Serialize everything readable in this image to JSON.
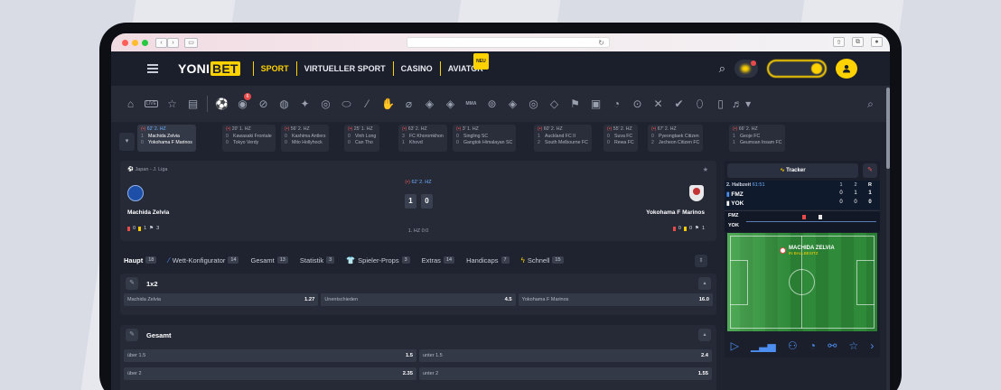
{
  "nav": {
    "logo_a": "YONI",
    "logo_b": "BET",
    "items": [
      "SPORT",
      "VIRTUELLER SPORT",
      "CASINO",
      "AVIATOR"
    ],
    "new_badge": "NEU"
  },
  "sports_icons": [
    "home-icon",
    "live-icon",
    "favorites-icon",
    "betslip-icon",
    "soccer-icon",
    "pitch-live-icon",
    "tennis-icon",
    "basketball-icon",
    "hockey-icon",
    "volleyball-icon",
    "rugby-icon",
    "baseball-icon",
    "handball-icon",
    "cricket-icon",
    "esports-soccer-icon",
    "esports-basket-icon",
    "mma-icon",
    "cycling-icon",
    "boxing-icon",
    "darts-icon",
    "table-tennis-icon",
    "flag-icon",
    "vr-icon",
    "snooker-icon",
    "golf-icon",
    "badminton-icon",
    "beach-icon",
    "rugby-league-icon",
    "chess-icon",
    "more-icon"
  ],
  "sports_bar": {
    "live_label": "LIVE",
    "mma_label": "MMA",
    "live_badge": "6"
  },
  "ticker": [
    {
      "time": "62' 2. HZ",
      "home_score": "1",
      "home": "Machida Zelvia",
      "away_score": "0",
      "away": "Yokohama F Marinos"
    },
    {
      "time": "20' 1. HZ",
      "home_score": "0",
      "home": "Kawasaki Frontale",
      "away_score": "0",
      "away": "Tokyo Verdy"
    },
    {
      "time": "56' 2. HZ",
      "home_score": "0",
      "home": "Kashima Antlers",
      "away_score": "0",
      "away": "Mito Hollyhock"
    },
    {
      "time": "25' 1. HZ",
      "home_score": "0",
      "home": "Vinh Long",
      "away_score": "0",
      "away": "Can Tho"
    },
    {
      "time": "63' 2. HZ",
      "home_score": "3",
      "home": "FC Khoromkhon",
      "away_score": "1",
      "away": "Khovd"
    },
    {
      "time": "3' 1. HZ",
      "home_score": "0",
      "home": "Singling SC",
      "away_score": "0",
      "away": "Gangtok Himalayan SC"
    },
    {
      "time": "60' 2. HZ",
      "home_score": "1",
      "home": "Auckland FC II",
      "away_score": "2",
      "away": "South Melbourne FC"
    },
    {
      "time": "55' 2. HZ",
      "home_score": "0",
      "home": "Suva FC",
      "away_score": "0",
      "away": "Rewa FC"
    },
    {
      "time": "67' 2. HZ",
      "home_score": "0",
      "home": "Pyeongtaek Citizen",
      "away_score": "2",
      "away": "Jecheon Citizen FC"
    },
    {
      "time": "66' 2. HZ",
      "home_score": "1",
      "home": "Geoje FC",
      "away_score": "1",
      "away": "Geumsan Insam FC"
    }
  ],
  "match": {
    "league": "Japan - J. Liga",
    "time": "62' 2. HZ",
    "home": "Machida Zelvia",
    "away": "Yokohama F Marinos",
    "home_score": "1",
    "away_score": "0",
    "half_score": "1. HZ 0:0",
    "home_stats": {
      "red": "0",
      "yellow": "1",
      "corners": "3"
    },
    "away_stats": {
      "red": "0",
      "yellow": "0",
      "corners": "1"
    }
  },
  "market_tabs": [
    {
      "label": "Haupt",
      "count": "18"
    },
    {
      "label": "Wett-Konfigurator",
      "count": "14"
    },
    {
      "label": "Gesamt",
      "count": "13"
    },
    {
      "label": "Statistik",
      "count": "3"
    },
    {
      "label": "Spieler-Props",
      "count": "3"
    },
    {
      "label": "Extras",
      "count": "14"
    },
    {
      "label": "Handicaps",
      "count": "7"
    },
    {
      "label": "Schnell",
      "count": "15"
    }
  ],
  "markets": {
    "m1x2": {
      "title": "1x2",
      "odds": [
        {
          "label": "Machida Zelvia",
          "value": "1.27"
        },
        {
          "label": "Unentschieden",
          "value": "4.5"
        },
        {
          "label": "Yokohama F Marinos",
          "value": "16.0"
        }
      ]
    },
    "total": {
      "title": "Gesamt",
      "rows": [
        [
          {
            "label": "über 1.5",
            "value": "1.5"
          },
          {
            "label": "unter 1.5",
            "value": "2.4"
          }
        ],
        [
          {
            "label": "über 2",
            "value": "2.35"
          },
          {
            "label": "unter 2",
            "value": "1.55"
          }
        ]
      ]
    }
  },
  "tracker": {
    "button": "Tracker",
    "period": "2. Halbzeit",
    "clock": "61:51",
    "col_headers": [
      "1",
      "2",
      "R"
    ],
    "home_abbr": "FMZ",
    "away_abbr": "YOK",
    "home_row": [
      "0",
      "1",
      "1"
    ],
    "away_row": [
      "0",
      "0",
      "0"
    ],
    "ball_team": "MACHIDA ZELVIA",
    "ball_state": "IN BALLBESITZ"
  }
}
